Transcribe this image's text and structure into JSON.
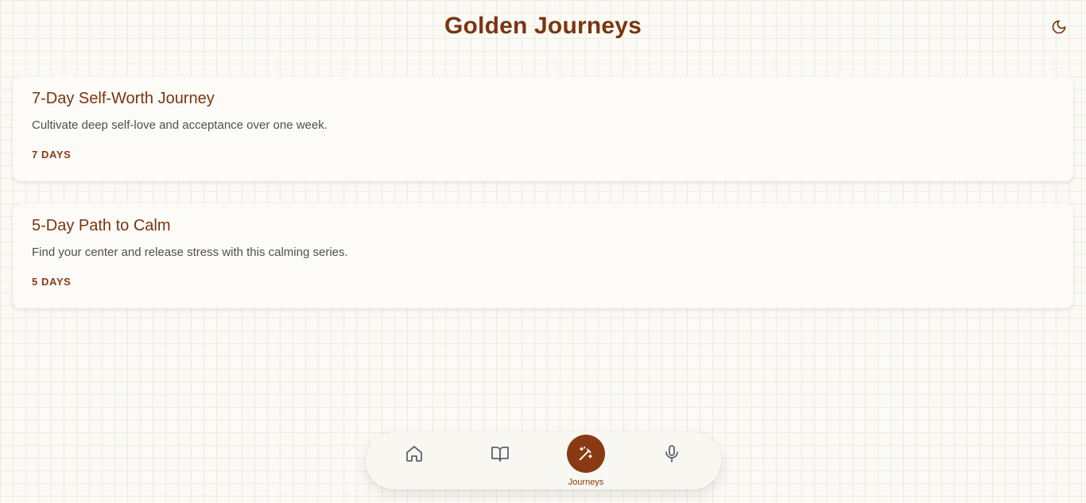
{
  "header": {
    "title": "Golden Journeys",
    "theme_toggle_icon": "moon-icon"
  },
  "journeys": [
    {
      "title": "7-Day Self-Worth Journey",
      "description": "Cultivate deep self-love and acceptance over one week.",
      "duration": "7 DAYS"
    },
    {
      "title": "5-Day Path to Calm",
      "description": "Find your center and release stress with this calming series.",
      "duration": "5 DAYS"
    }
  ],
  "nav": {
    "items": [
      {
        "icon": "home-icon",
        "label": ""
      },
      {
        "icon": "book-open-icon",
        "label": ""
      },
      {
        "icon": "magic-wand-icon",
        "label": "Journeys",
        "active": true
      },
      {
        "icon": "microphone-icon",
        "label": ""
      }
    ]
  },
  "colors": {
    "accent": "#7a3510",
    "active_nav": "#8a3a12",
    "background": "#fbfaf6"
  }
}
